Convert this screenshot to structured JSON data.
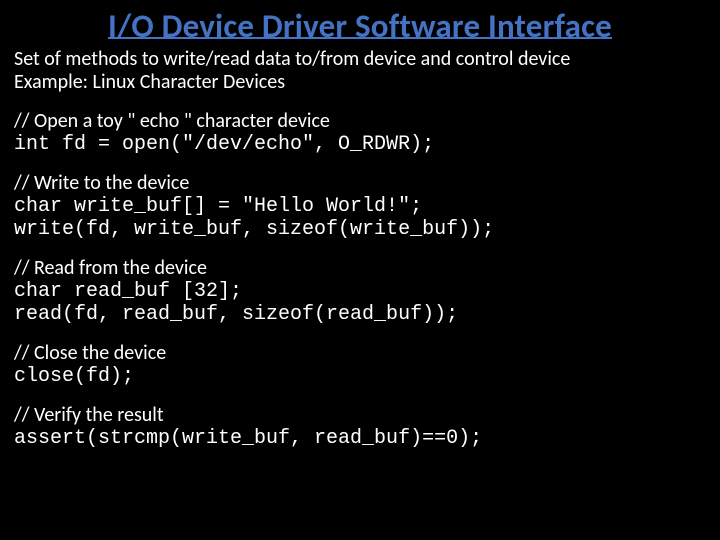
{
  "title": "I/O Device Driver Software Interface",
  "intro_line1": "Set of methods to write/read data to/from device and control device",
  "intro_line2": "Example: Linux Character Devices",
  "sections": [
    {
      "comment": "// Open a toy \" echo \" character device",
      "code": "int fd = open(\"/dev/echo\", O_RDWR);"
    },
    {
      "comment": "// Write to the device",
      "code": "char write_buf[] = \"Hello World!\";\nwrite(fd, write_buf, sizeof(write_buf));"
    },
    {
      "comment": "// Read from the device",
      "code": "char read_buf [32];\nread(fd, read_buf, sizeof(read_buf));"
    },
    {
      "comment": "// Close the device",
      "code": "close(fd);"
    },
    {
      "comment": "// Verify the result",
      "code": "assert(strcmp(write_buf, read_buf)==0);"
    }
  ]
}
